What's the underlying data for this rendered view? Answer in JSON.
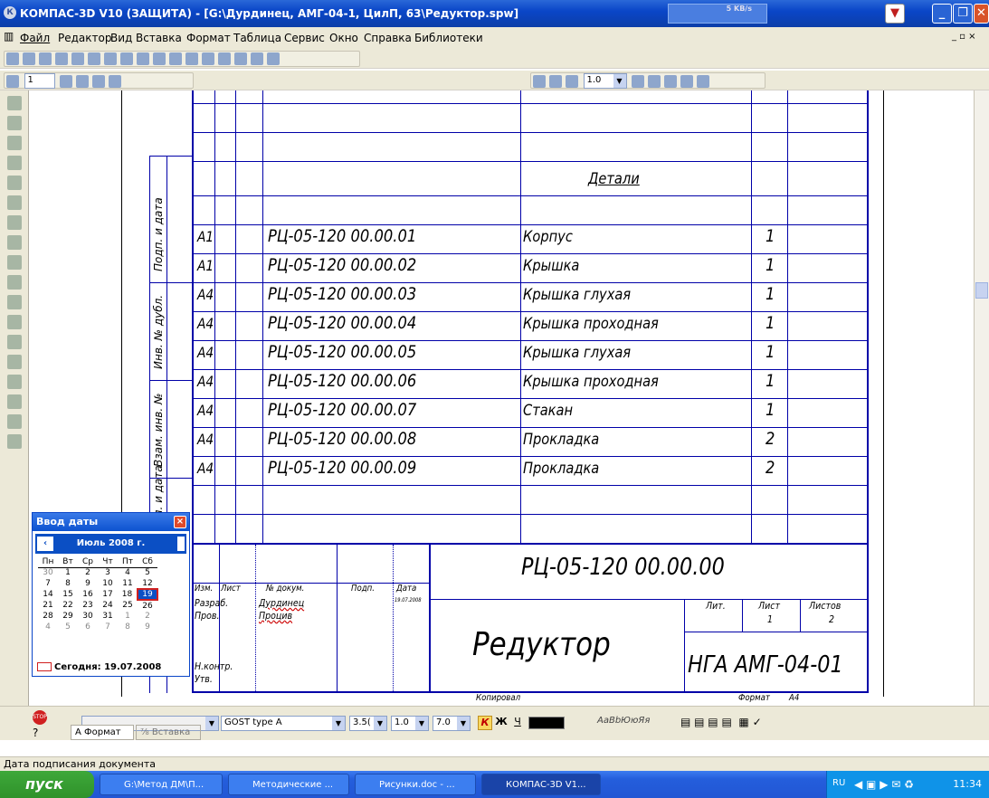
{
  "window": {
    "title": "КОМПАС-3D V10 (ЗАЩИТА) - [G:\\Дурдинец, АМГ-04-1, ЦилП, 63\\Редуктор.spw]",
    "net_speed": "5 KB/s"
  },
  "menu": [
    "Файл",
    "Редактор",
    "Вид",
    "Вставка",
    "Формат",
    "Таблица",
    "Сервис",
    "Окно",
    "Справка",
    "Библиотеки"
  ],
  "toolbar2": {
    "layer_value": "1",
    "zoom_value": "1.0"
  },
  "spec": {
    "section_title": "Детали",
    "rows": [
      {
        "format": "A1",
        "designation": "РЦ-05-120 00.00.01",
        "name": "Корпус",
        "qty": "1"
      },
      {
        "format": "A1",
        "designation": "РЦ-05-120 00.00.02",
        "name": "Крышка",
        "qty": "1"
      },
      {
        "format": "A4",
        "designation": "РЦ-05-120 00.00.03",
        "name": "Крышка глухая",
        "qty": "1"
      },
      {
        "format": "A4",
        "designation": "РЦ-05-120 00.00.04",
        "name": "Крышка проходная",
        "qty": "1"
      },
      {
        "format": "A4",
        "designation": "РЦ-05-120 00.00.05",
        "name": "Крышка глухая",
        "qty": "1"
      },
      {
        "format": "A4",
        "designation": "РЦ-05-120 00.00.06",
        "name": "Крышка проходная",
        "qty": "1"
      },
      {
        "format": "A4",
        "designation": "РЦ-05-120 00.00.07",
        "name": "Стакан",
        "qty": "1"
      },
      {
        "format": "A4",
        "designation": "РЦ-05-120 00.00.08",
        "name": "Прокладка",
        "qty": "2"
      },
      {
        "format": "A4",
        "designation": "РЦ-05-120 00.00.09",
        "name": "Прокладка",
        "qty": "2"
      }
    ],
    "side_labels": [
      "Подп. и дата",
      "Инв. № дубл.",
      "Взам. инв. №",
      "Подп. и дата"
    ],
    "stamp": {
      "designation": "РЦ-05-120 00.00.00",
      "title": "Редуктор",
      "org": "НГА АМГ-04-01",
      "hdr_izm": "Изм.",
      "hdr_list": "Лист",
      "hdr_doc": "№ докум.",
      "hdr_sign": "Подп.",
      "hdr_date": "Дата",
      "razrab": "Разраб.",
      "razrab_name": "Дурдинец",
      "razrab_date": "19.07.2008",
      "prov": "Пров.",
      "prov_name": "Процив",
      "nkontr": "Н.контр.",
      "utv": "Утв.",
      "lit": "Лит.",
      "list": "Лист",
      "listov": "Листов",
      "list_value": "1",
      "listov_value": "2",
      "kopiroval": "Копировал",
      "format_label": "Формат",
      "format_value": "A4"
    }
  },
  "calendar": {
    "title": "Ввод даты",
    "month": "Июль 2008 г.",
    "weekdays": [
      "Пн",
      "Вт",
      "Ср",
      "Чт",
      "Пт",
      "Сб"
    ],
    "weeks": [
      [
        "30",
        "1",
        "2",
        "3",
        "4",
        "5"
      ],
      [
        "7",
        "8",
        "9",
        "10",
        "11",
        "12"
      ],
      [
        "14",
        "15",
        "16",
        "17",
        "18",
        "19"
      ],
      [
        "21",
        "22",
        "23",
        "24",
        "25",
        "26"
      ],
      [
        "28",
        "29",
        "30",
        "31",
        "1",
        "2"
      ],
      [
        "4",
        "5",
        "6",
        "7",
        "8",
        "9"
      ]
    ],
    "today": "Сегодня: 19.07.2008"
  },
  "format_bar": {
    "font": "GOST type A",
    "size": "3.5(",
    "scale": "1.0",
    "spacing": "7.0",
    "sample": "АаBbЮюЯя",
    "tab_format": "Формат",
    "tab_insert": "Вставка"
  },
  "status": "Дата подписания документа",
  "taskbar": {
    "start": "пуск",
    "tasks": [
      "G:\\Метод ДМ\\П...",
      "Методические ...",
      "Рисунки.doc - ...",
      "КОМПАС-3D V1..."
    ],
    "lang": "RU",
    "clock": "11:34"
  }
}
